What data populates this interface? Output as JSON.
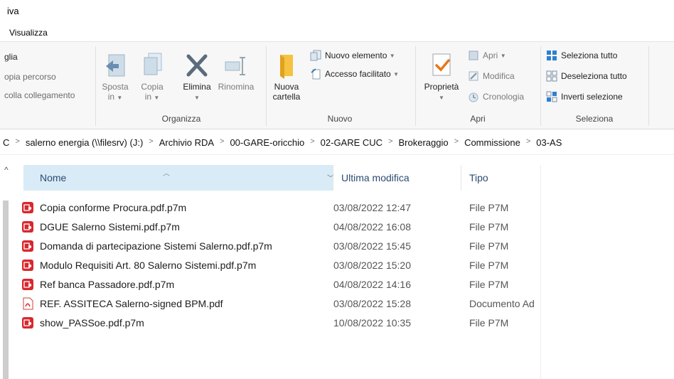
{
  "window": {
    "title": "iva"
  },
  "menu": {
    "tab_view": "Visualizza"
  },
  "ribbon": {
    "clipboard": {
      "cut_partial": "glia",
      "copy_path_partial": "opia percorso",
      "paste_link_partial": "colla collegamento"
    },
    "organize": {
      "label": "Organizza",
      "move_to_line1": "Sposta",
      "move_to_line2": "in",
      "copy_to_line1": "Copia",
      "copy_to_line2": "in",
      "delete": "Elimina",
      "rename": "Rinomina"
    },
    "new": {
      "label": "Nuovo",
      "new_folder_line1": "Nuova",
      "new_folder_line2": "cartella",
      "new_item": "Nuovo elemento",
      "easy_access": "Accesso facilitato"
    },
    "open": {
      "label": "Apri",
      "properties": "Proprietà",
      "open": "Apri",
      "edit": "Modifica",
      "history": "Cronologia"
    },
    "select": {
      "label": "Seleziona",
      "select_all": "Seleziona tutto",
      "select_none": "Deseleziona tutto",
      "invert": "Inverti selezione"
    }
  },
  "address": {
    "crumbs": [
      "C",
      "salerno energia (\\\\filesrv) (J:)",
      "Archivio RDA",
      "00-GARE-oricchio",
      "02-GARE CUC",
      "Brokeraggio",
      "Commissione",
      "03-AS"
    ]
  },
  "columns": {
    "name": "Nome",
    "modified": "Ultima modifica",
    "type": "Tipo"
  },
  "files": [
    {
      "name": "Copia conforme Procura.pdf.p7m",
      "modified": "03/08/2022 12:47",
      "type": "File P7M",
      "icon": "p7m-file-icon"
    },
    {
      "name": "DGUE Salerno Sistemi.pdf.p7m",
      "modified": "04/08/2022 16:08",
      "type": "File P7M",
      "icon": "p7m-file-icon"
    },
    {
      "name": "Domanda di partecipazione Sistemi Salerno.pdf.p7m",
      "modified": "03/08/2022 15:45",
      "type": "File P7M",
      "icon": "p7m-file-icon"
    },
    {
      "name": "Modulo Requisiti Art. 80 Salerno Sistemi.pdf.p7m",
      "modified": "03/08/2022 15:20",
      "type": "File P7M",
      "icon": "p7m-file-icon"
    },
    {
      "name": "Ref banca Passadore.pdf.p7m",
      "modified": "04/08/2022 14:16",
      "type": "File P7M",
      "icon": "p7m-file-icon"
    },
    {
      "name": "REF. ASSITECA Salerno-signed BPM.pdf",
      "modified": "03/08/2022 15:28",
      "type": "Documento Ad",
      "icon": "pdf-file-icon"
    },
    {
      "name": "show_PASSoe.pdf.p7m",
      "modified": "10/08/2022 10:35",
      "type": "File P7M",
      "icon": "p7m-file-icon"
    }
  ],
  "colors": {
    "accent": "#0078d7",
    "header_selected": "#d9ebf7",
    "p7m_red": "#d9272e"
  }
}
